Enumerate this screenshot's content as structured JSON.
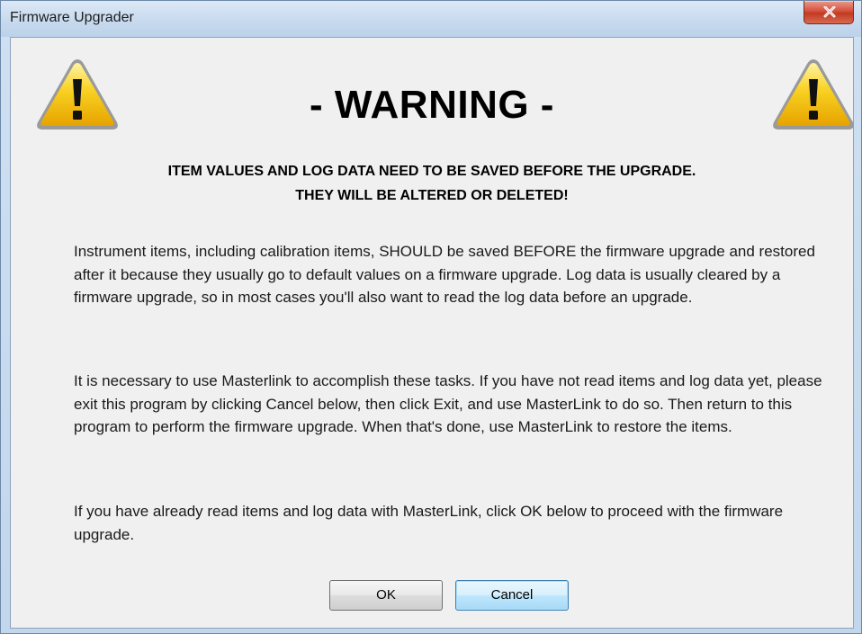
{
  "window": {
    "title": "Firmware Upgrader",
    "close_icon": "close-icon"
  },
  "dialog": {
    "heading": "- WARNING -",
    "subheading_line1": "ITEM VALUES AND LOG DATA NEED TO BE SAVED BEFORE THE UPGRADE.",
    "subheading_line2": "THEY WILL BE ALTERED OR DELETED!",
    "paragraph1": "Instrument items, including calibration items, SHOULD be saved BEFORE the firmware upgrade and restored after it because they usually go to default values on a firmware upgrade. Log data is usually cleared by a firmware upgrade, so in most cases you'll also want to read the log data before an upgrade.",
    "paragraph2": "It is necessary to use Masterlink to accomplish these tasks. If you have not read items and log data yet, please exit this program by clicking Cancel below, then click Exit, and use MasterLink to do so. Then return to this program to perform the firmware upgrade. When that's done, use MasterLink to restore the items.",
    "paragraph3": "If you have already read items and log data with MasterLink, click OK below to proceed with the firmware upgrade.",
    "icons": [
      "warning-icon",
      "warning-icon"
    ]
  },
  "buttons": {
    "ok_label": "OK",
    "cancel_label": "Cancel"
  },
  "colors": {
    "title_bar": "#c6d9ee",
    "close_button": "#d6513c",
    "client_background": "#f0f0f0",
    "warning_yellow": "#f5c400",
    "focused_button": "#bee6fd"
  }
}
